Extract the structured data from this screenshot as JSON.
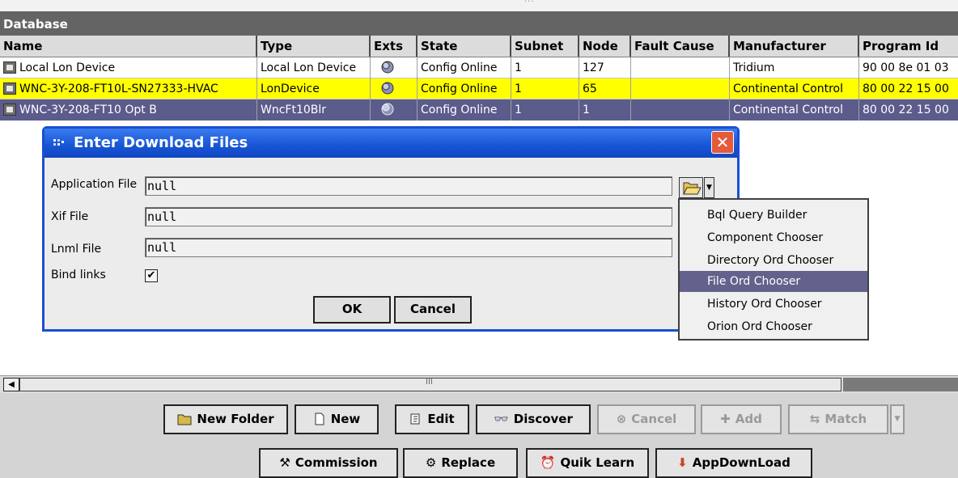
{
  "window": {
    "title": "Database"
  },
  "table": {
    "columns": [
      "Name",
      "Type",
      "Exts",
      "State",
      "Subnet",
      "Node",
      "Fault Cause",
      "Manufacturer",
      "Program Id"
    ],
    "rows": [
      {
        "name": "Local Lon Device",
        "type": "Local Lon Device",
        "state": "Config Online",
        "subnet": "1",
        "node": "127",
        "fault_cause": "",
        "manufacturer": "Tridium",
        "program_id": "90 00 8e 01 03"
      },
      {
        "name": "WNC-3Y-208-FT10L-SN27333-HVAC",
        "type": "LonDevice",
        "state": "Config Online",
        "subnet": "1",
        "node": "65",
        "fault_cause": "",
        "manufacturer": "Continental Control",
        "program_id": "80 00 22 15 00"
      },
      {
        "name": "WNC-3Y-208-FT10 Opt B",
        "type": "WncFt10Blr",
        "state": "Config Online",
        "subnet": "1",
        "node": "1",
        "fault_cause": "",
        "manufacturer": "Continental Control",
        "program_id": "80 00 22 15 00"
      }
    ]
  },
  "dialog": {
    "title": "Enter Download Files",
    "close": "✕",
    "fields": {
      "application_label": "Application File",
      "application_value": "null",
      "xif_label": "Xif File",
      "xif_value": "null",
      "lnml_label": "Lnml File",
      "lnml_value": "null",
      "bind_label": "Bind links",
      "bind_checked": "✔"
    },
    "ok": "OK",
    "cancel": "Cancel"
  },
  "chooser_menu": {
    "items": [
      "Bql Query Builder",
      "Component Chooser",
      "Directory Ord Chooser",
      "File Ord Chooser",
      "History Ord Chooser",
      "Orion Ord Chooser"
    ],
    "selected": "File Ord Chooser"
  },
  "scrollbar": {
    "grip": "III"
  },
  "toolbar": {
    "row1": {
      "new_folder": "New Folder",
      "new": "New",
      "edit": "Edit",
      "discover": "Discover",
      "cancel": "Cancel",
      "add": "Add",
      "match": "Match"
    },
    "row2": {
      "commission": "Commission",
      "replace": "Replace",
      "quik_learn": "Quik Learn",
      "appdownload": "AppDownLoad"
    }
  },
  "colors": {
    "selected_row": "#5b5b8c",
    "highlight_row": "#ffff00",
    "title_bar": "#1957d6",
    "header_bar": "#646464"
  }
}
